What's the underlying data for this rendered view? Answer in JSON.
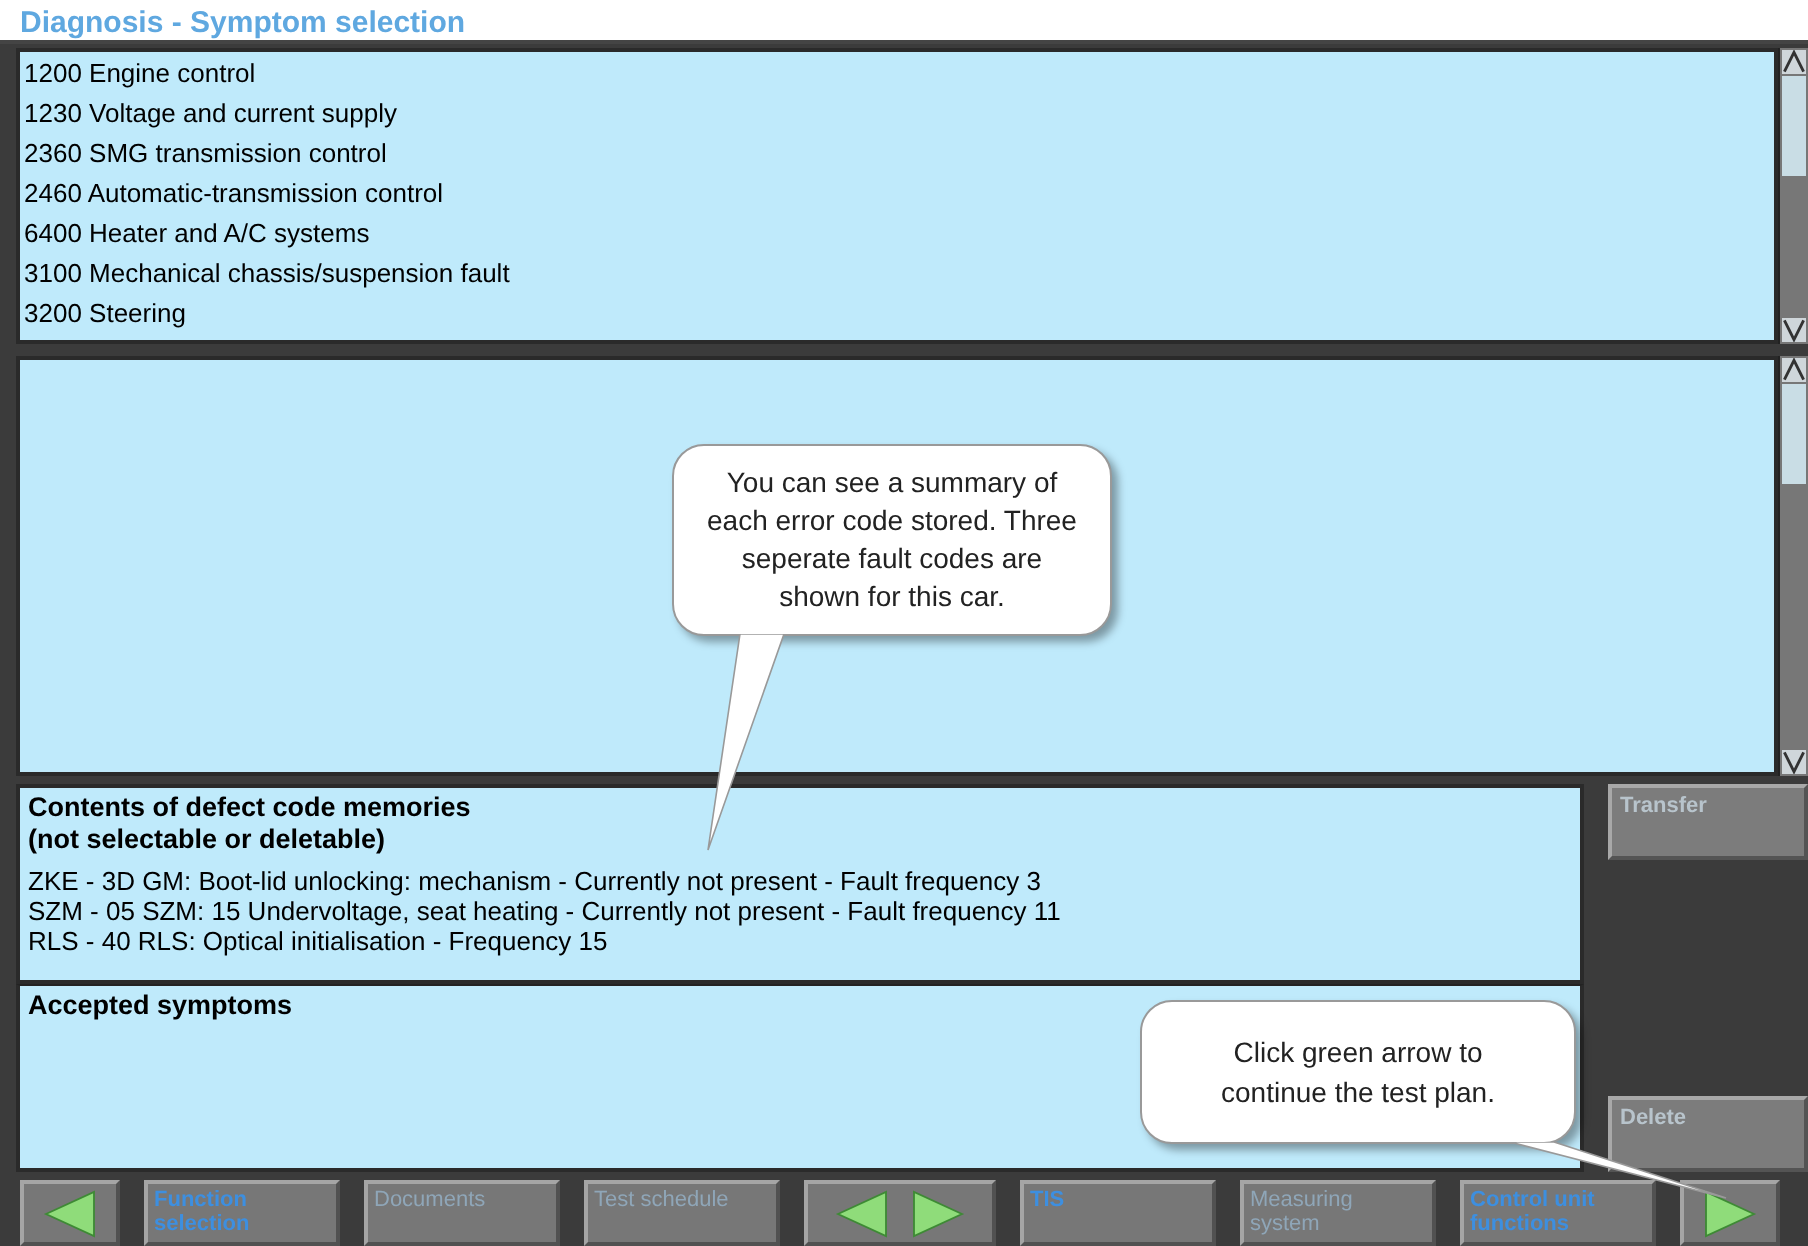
{
  "window": {
    "title": "Diagnosis - Symptom selection"
  },
  "symptom_list": {
    "items": [
      {
        "text": "1200 Engine control"
      },
      {
        "text": "1230 Voltage and current supply"
      },
      {
        "text": "2360 SMG transmission control"
      },
      {
        "text": "2460 Automatic-transmission control"
      },
      {
        "text": "6400 Heater and A/C systems"
      },
      {
        "text": "3100 Mechanical chassis/suspension fault"
      },
      {
        "text": "3200 Steering"
      }
    ]
  },
  "defect_memory": {
    "heading": "Contents of defect code memories",
    "subheading": "(not selectable or deletable)",
    "entries": [
      "ZKE - 3D GM: Boot-lid unlocking: mechanism - Currently not present - Fault frequency 3",
      "SZM - 05 SZM: 15 Undervoltage, seat heating - Currently not present - Fault frequency 11",
      "RLS - 40 RLS: Optical initialisation - Frequency 15"
    ]
  },
  "accepted_symptoms": {
    "heading": "Accepted symptoms"
  },
  "side_buttons": [
    {
      "label": "Transfer",
      "disabled": true
    },
    {
      "label": "Delete",
      "disabled": true
    }
  ],
  "toolbar": [
    {
      "kind": "back"
    },
    {
      "kind": "label",
      "label": "Function selection",
      "disabled": false
    },
    {
      "kind": "label",
      "label": "Documents",
      "disabled": true
    },
    {
      "kind": "label",
      "label": "Test schedule",
      "disabled": true
    },
    {
      "kind": "pair"
    },
    {
      "kind": "label",
      "label": "TIS",
      "disabled": false
    },
    {
      "kind": "label",
      "label": "Measuring system",
      "disabled": true
    },
    {
      "kind": "label",
      "label": "Control unit functions",
      "disabled": false
    },
    {
      "kind": "forward"
    }
  ],
  "callouts": [
    {
      "text": "You can see a summary of each error code stored. Three seperate fault codes are shown for this car."
    },
    {
      "text": "Click green arrow to continue the test plan."
    }
  ]
}
